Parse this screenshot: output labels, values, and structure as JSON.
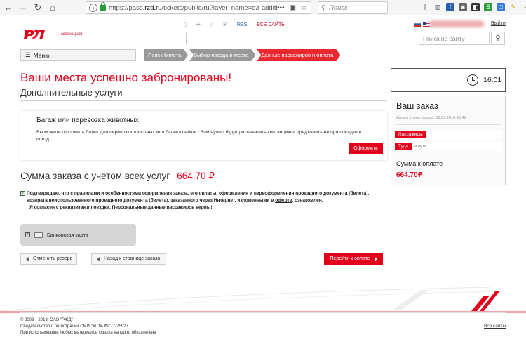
{
  "browser": {
    "url_prefix": "https://pass.",
    "url_domain": "rzd.ru",
    "url_rest": "/tickets/public/ru?layer_name=e3-additio",
    "url_more": "•••",
    "search_placeholder": "Поиск"
  },
  "header": {
    "logo_caption": "Пассажирам",
    "links": [
      "RSS",
      "ВСЕ САЙТЫ"
    ],
    "logout": "Выйти",
    "site_search_placeholder": "Поиск по сайту"
  },
  "nav": {
    "menu_label": "Меню",
    "breadcrumbs": [
      "Поиск билета",
      "Выбор поезда и места",
      "Данные пассажиров и оплата"
    ]
  },
  "main": {
    "success_title": "Ваши места успешно забронированы!",
    "extra_title": "Дополнительные услуги",
    "baggage": {
      "title": "Багаж или перевозка животных",
      "desc": "Вы можете оформить билет для перевозки животных или багажа сейчас. Вам нужно будет распечатать квитанцию и предъявить ее при посадке в поезд.",
      "button": "Оформить"
    },
    "sum_label": "Сумма заказа с учетом всех услуг",
    "sum_amount": "664.70 ₽",
    "agree_text_1": "Подтверждаю, что с правилами и особенностями оформления заказа, его оплаты, оформления и переоформления проездного документа (билета), возврата неиспользованного проездного документа (билета), заказанного через Интернет, изложенными в ",
    "agree_link": "оферте",
    "agree_text_2": ", ознакомлен.",
    "agree_text_3": "Я согласен с реквизитами поездки. Персональные данные пассажиров верны!",
    "payment_method": "Банковская карта",
    "btn_cancel": "Отменить резерв",
    "btn_back": "Назад к странице заказа",
    "btn_pay": "Перейти к оплате"
  },
  "sidebar": {
    "timer": "16:01",
    "order_title": "Ваш заказ",
    "order_date": "Дата и время заказа: 16.02.2018 12:42",
    "tag_passengers": "Пассажиры",
    "tag_direction": "Туда",
    "direction_sub": "в пути",
    "pay_label": "Сумма к оплате",
    "pay_amount": "664.70₽"
  },
  "footer": {
    "line1": "© 2003—2018. ОАО \"РЖД\"",
    "line2": "Свидетельство о регистрации СМИ Эл. № ФС77-25927",
    "line3": "При использовании любых материалов ссылка на rzd.ru обязательна",
    "all_sites": "Все сайты"
  },
  "colors": {
    "brand_red": "#e2001a",
    "crumb_grey": "#999999"
  }
}
